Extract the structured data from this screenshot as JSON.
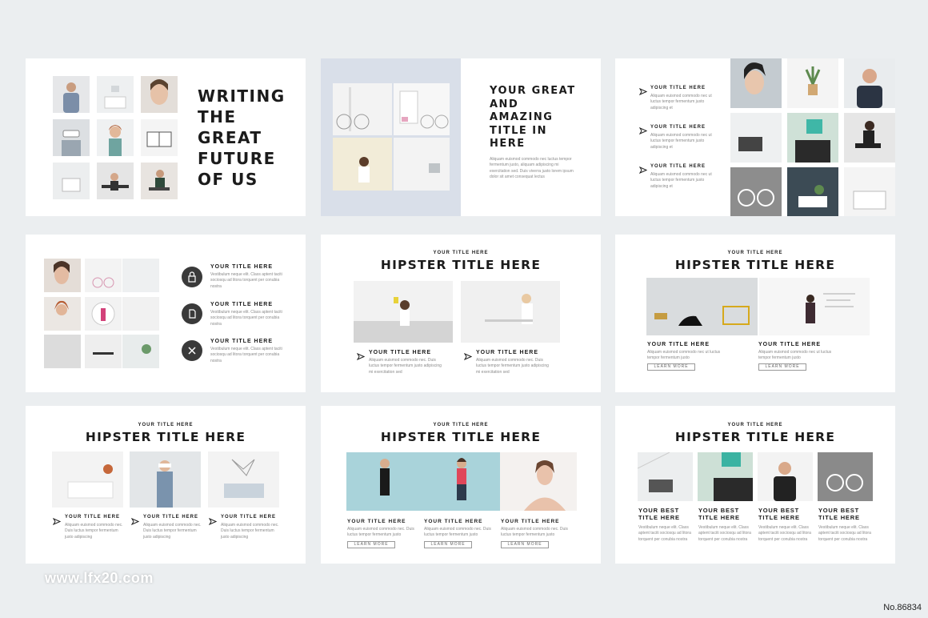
{
  "slide1": {
    "title": "WRITING THE GREAT FUTURE OF US"
  },
  "slide2": {
    "title": "YOUR GREAT AND AMAZING TITLE IN HERE",
    "body": "Aliquam euismod commodo nec luctus tempor fermentum justo, aliquam adipiscing mi exercitation sed. Duis viverra justo lorem ipsum dolor sit amet consequat lectus"
  },
  "slide3": {
    "items": [
      {
        "title": "YOUR TITLE HERE",
        "body": "Aliquam euismod commodo nec ut luctus tempor fermentum justo adipiscing et"
      },
      {
        "title": "YOUR TITLE HERE",
        "body": "Aliquam euismod commodo nec ut luctus tempor fermentum justo adipiscing et"
      },
      {
        "title": "YOUR TITLE HERE",
        "body": "Aliquam euismod commodo nec ut luctus tempor fermentum justo adipiscing et"
      }
    ]
  },
  "slide4": {
    "items": [
      {
        "icon": "lock-icon",
        "title": "YOUR TITLE HERE",
        "body": "Vestibulum neque elit. Class aptent taciti sociosqu ad litora torquent per conubia nostra"
      },
      {
        "icon": "document-icon",
        "title": "YOUR TITLE HERE",
        "body": "Vestibulum neque elit. Class aptent taciti sociosqu ad litora torquent per conubia nostra"
      },
      {
        "icon": "tools-icon",
        "title": "YOUR TITLE HERE",
        "body": "Vestibulum neque elit. Class aptent taciti sociosqu ad litora torquent per conubia nostra"
      }
    ]
  },
  "slide5": {
    "kicker": "YOUR TITLE HERE",
    "title": "HIPSTER TITLE HERE",
    "items": [
      {
        "title": "YOUR TITLE HERE",
        "body": "Aliquam euismod commodo nec. Duis luctus tempor fermentum justo adipiscing mi exercitation sed"
      },
      {
        "title": "YOUR TITLE HERE",
        "body": "Aliquam euismod commodo nec. Duis luctus tempor fermentum justo adipiscing mi exercitation sed"
      }
    ]
  },
  "slide6": {
    "kicker": "YOUR TITLE HERE",
    "title": "HIPSTER TITLE HERE",
    "items": [
      {
        "title": "YOUR TITLE HERE",
        "body": "Aliquam euismod commodo nec ut luctus tempor fermentum justo",
        "button": "LEARN MORE"
      },
      {
        "title": "YOUR TITLE HERE",
        "body": "Aliquam euismod commodo nec ut luctus tempor fermentum justo",
        "button": "LEARN MORE"
      }
    ]
  },
  "slide7": {
    "kicker": "YOUR TITLE HERE",
    "title": "HIPSTER TITLE HERE",
    "items": [
      {
        "title": "YOUR TITLE HERE",
        "body": "Aliquam euismod commodo nec. Duis luctus tempor fermentum justo adipiscing"
      },
      {
        "title": "YOUR TITLE HERE",
        "body": "Aliquam euismod commodo nec. Duis luctus tempor fermentum justo adipiscing"
      },
      {
        "title": "YOUR TITLE HERE",
        "body": "Aliquam euismod commodo nec. Duis luctus tempor fermentum justo adipiscing"
      }
    ]
  },
  "slide8": {
    "kicker": "YOUR TITLE HERE",
    "title": "HIPSTER TITLE HERE",
    "items": [
      {
        "title": "YOUR TITLE HERE",
        "body": "Aliquam euismod commodo nec. Duis luctus tempor fermentum justo",
        "button": "LEARN MORE"
      },
      {
        "title": "YOUR TITLE HERE",
        "body": "Aliquam euismod commodo nec. Duis luctus tempor fermentum justo",
        "button": "LEARN MORE"
      },
      {
        "title": "YOUR TITLE HERE",
        "body": "Aliquam euismod commodo nec. Duis luctus tempor fermentum justo",
        "button": "LEARN MORE"
      }
    ]
  },
  "slide9": {
    "kicker": "YOUR TITLE HERE",
    "title": "HIPSTER TITLE HERE",
    "items": [
      {
        "title": "YOUR BEST TITLE HERE",
        "body": "Vestibulum neque elit. Class aptent taciti sociosqu ad litora torquent per conubia nostra"
      },
      {
        "title": "YOUR BEST TITLE HERE",
        "body": "Vestibulum neque elit. Class aptent taciti sociosqu ad litora torquent per conubia nostra"
      },
      {
        "title": "YOUR BEST TITLE HERE",
        "body": "Vestibulum neque elit. Class aptent taciti sociosqu ad litora torquent per conubia nostra"
      },
      {
        "title": "YOUR BEST TITLE HERE",
        "body": "Vestibulum neque elit. Class aptent taciti sociosqu ad litora torquent per conubia nostra"
      }
    ]
  },
  "watermark": "www.lfx20.com",
  "item_number": "No.86834",
  "colors": {
    "background": "#ebeef0",
    "slide": "#ffffff",
    "text": "#1b1b1b",
    "muted": "#8b8b8b",
    "icon_circle": "#3a3a3a",
    "panel_blue": "#d9dfe9"
  }
}
